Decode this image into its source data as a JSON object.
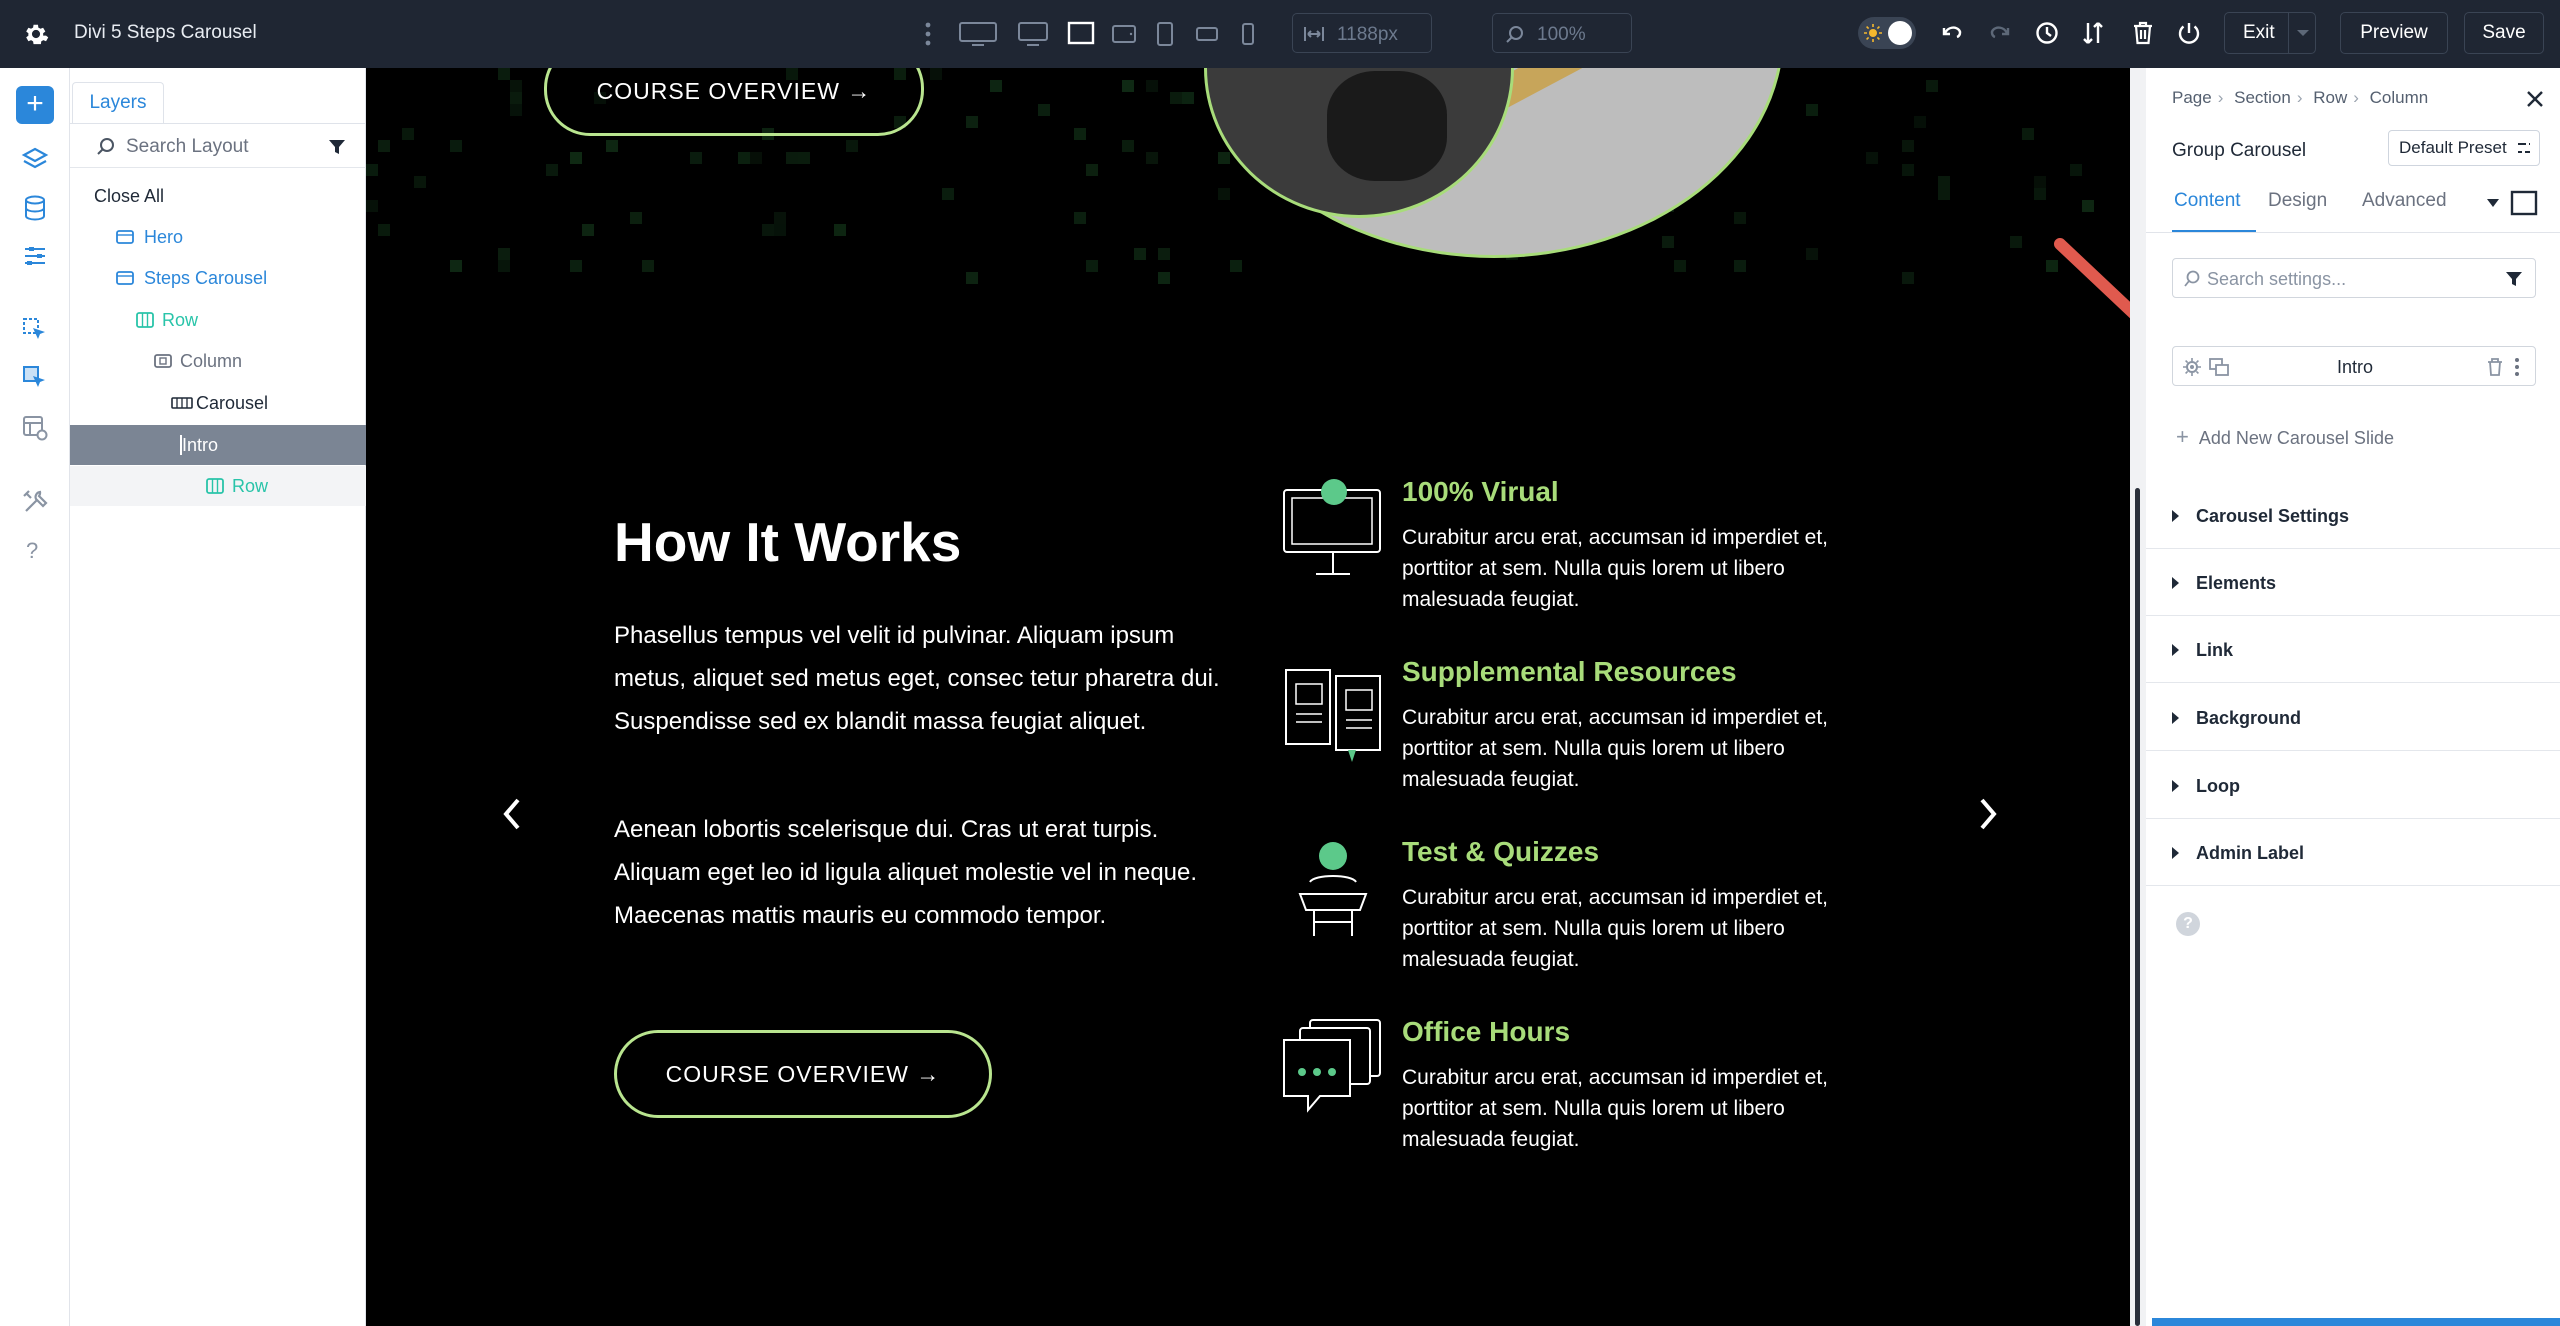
{
  "app": {
    "title": "Divi 5 Steps Carousel"
  },
  "toolbar": {
    "width_value": "1188px",
    "zoom_value": "100%",
    "exit_label": "Exit",
    "preview_label": "Preview",
    "save_label": "Save"
  },
  "layers_panel": {
    "tab_label": "Layers",
    "search_placeholder": "Search Layout",
    "close_all": "Close All",
    "items": [
      {
        "label": "Hero",
        "color": "#2b87da"
      },
      {
        "label": "Steps Carousel",
        "color": "#2b87da"
      },
      {
        "label": "Row",
        "color": "#29c4a9"
      },
      {
        "label": "Column",
        "color": "#6b7280"
      },
      {
        "label": "Carousel",
        "color": "#1f2937"
      },
      {
        "label": "Intro",
        "color": "#ffffff"
      },
      {
        "label": "Row",
        "color": "#29c4a9"
      }
    ]
  },
  "canvas": {
    "top_button": "COURSE OVERVIEW →",
    "heading": "How It Works",
    "para1": "Phasellus tempus vel velit id pulvinar. Aliquam ipsum metus, aliquet sed metus eget, consec tetur pharetra dui. Suspendisse sed ex blandit massa feugiat aliquet.",
    "para2": "Aenean lobortis scelerisque dui. Cras ut erat turpis. Aliquam eget leo id ligula aliquet molestie vel in neque. Maecenas mattis mauris eu commodo tempor.",
    "button": "COURSE OVERVIEW →",
    "features": [
      {
        "title": "100% Virual",
        "body": "Curabitur arcu erat, accumsan id imperdiet et, porttitor at sem. Nulla quis lorem ut libero malesuada feugiat.",
        "icon": "computer-icon"
      },
      {
        "title": "Supplemental Resources",
        "body": "Curabitur arcu erat, accumsan id imperdiet et, porttitor at sem. Nulla quis lorem ut libero malesuada feugiat.",
        "icon": "books-icon"
      },
      {
        "title": "Test & Quizzes",
        "body": "Curabitur arcu erat, accumsan id imperdiet et, porttitor at sem. Nulla quis lorem ut libero malesuada feugiat.",
        "icon": "lectern-icon"
      },
      {
        "title": "Office Hours",
        "body": "Curabitur arcu erat, accumsan id imperdiet et, porttitor at sem. Nulla quis lorem ut libero malesuada feugiat.",
        "icon": "chat-icon"
      }
    ],
    "accent": "#a8dc7a"
  },
  "settings": {
    "breadcrumbs": [
      "Page",
      "Section",
      "Row",
      "Column"
    ],
    "title": "Group Carousel",
    "preset": "Default Preset",
    "tabs": [
      "Content",
      "Design",
      "Advanced"
    ],
    "search_placeholder": "Search settings...",
    "slide_label": "Intro",
    "add_slide": "Add New Carousel Slide",
    "sections": [
      "Carousel Settings",
      "Elements",
      "Link",
      "Background",
      "Loop",
      "Admin Label"
    ]
  }
}
